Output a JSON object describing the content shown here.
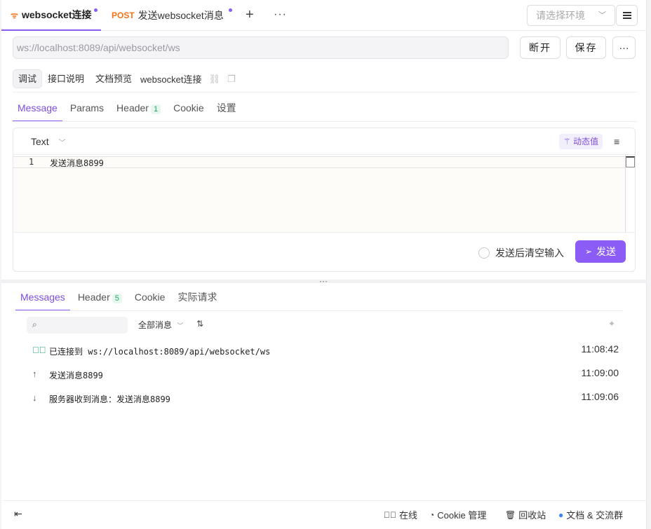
{
  "tabs": [
    {
      "label": "websocket连接",
      "icon": "websocket-icon"
    },
    {
      "method": "POST",
      "label": "发送websocket消息"
    }
  ],
  "env_select": {
    "placeholder": "请选择环境"
  },
  "url": "ws://localhost:8089/api/websocket/ws",
  "actions": {
    "disconnect": "断开",
    "save": "保存",
    "more": "···"
  },
  "subtabs": [
    "调试",
    "接口说明",
    "文档预览"
  ],
  "api_name": "websocket连接",
  "request_tabs": [
    {
      "label": "Message"
    },
    {
      "label": "Params"
    },
    {
      "label": "Header",
      "badge": "1"
    },
    {
      "label": "Cookie"
    },
    {
      "label": "设置"
    }
  ],
  "editor": {
    "type": "Text",
    "dynamic_label": "动态值",
    "line_number": "1",
    "content": "发送消息8899",
    "clear_after_send": "发送后清空输入",
    "send_label": "发送"
  },
  "response_tabs": [
    {
      "label": "Messages"
    },
    {
      "label": "Header",
      "badge": "5"
    },
    {
      "label": "Cookie"
    },
    {
      "label": "实际请求"
    }
  ],
  "filter_label": "全部消息",
  "messages": [
    {
      "type": "connected",
      "icon": "check-circle-icon",
      "text": "已连接到 ws://localhost:8089/api/websocket/ws",
      "time": "11:08:42"
    },
    {
      "type": "sent",
      "icon": "arrow-up-icon",
      "text": "发送消息8899",
      "time": "11:09:00"
    },
    {
      "type": "received",
      "icon": "arrow-down-icon",
      "text": "服务器收到消息：发送消息8899",
      "time": "11:09:06"
    }
  ],
  "footer": {
    "online": "在线",
    "cookie": "Cookie 管理",
    "recycle": "回收站",
    "docs": "文档 & 交流群"
  },
  "colors": {
    "accent": "#8b5cf6",
    "post": "#f97316",
    "success": "#22a56b"
  }
}
